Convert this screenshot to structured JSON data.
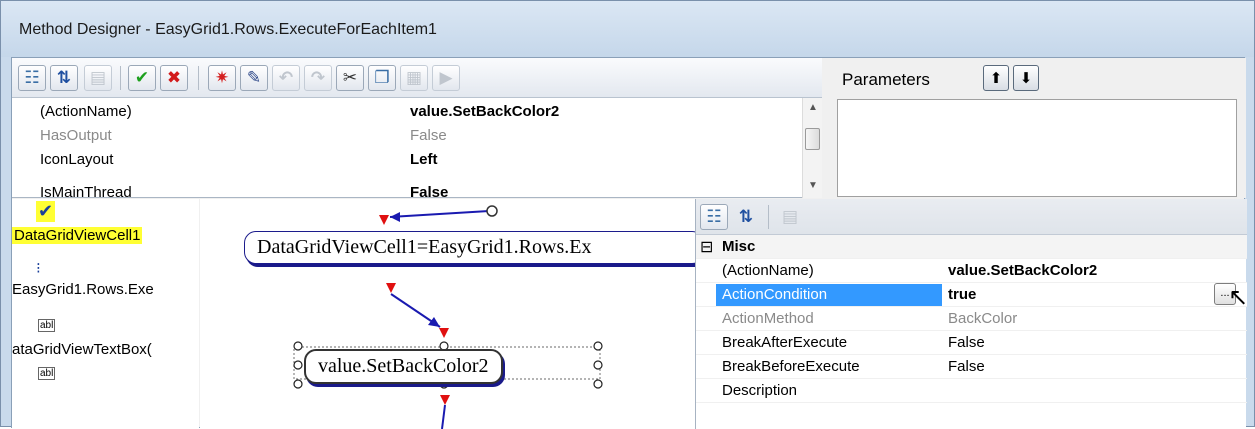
{
  "window": {
    "title": "Method Designer - EasyGrid1.Rows.ExecuteForEachItem1"
  },
  "toolbar": {
    "buttons": [
      {
        "name": "categorized-view-button",
        "glyph": "☷"
      },
      {
        "name": "alphabetical-sort-button",
        "glyph": "⇅"
      },
      {
        "name": "property-pages-button",
        "glyph": "▤"
      },
      {
        "name": "ok-button",
        "glyph": "✔"
      },
      {
        "name": "cancel-button",
        "glyph": "✖"
      },
      {
        "name": "debug-button",
        "glyph": "✷"
      },
      {
        "name": "magic-wand-button",
        "glyph": "✎"
      },
      {
        "name": "undo-button",
        "glyph": "↶"
      },
      {
        "name": "redo-button",
        "glyph": "↷"
      },
      {
        "name": "cut-button",
        "glyph": "✂"
      },
      {
        "name": "copy-button",
        "glyph": "❐"
      },
      {
        "name": "paste-button",
        "glyph": "▦"
      },
      {
        "name": "run-button",
        "glyph": "▶"
      }
    ]
  },
  "top_properties": [
    {
      "name": "(ActionName)",
      "value": "value.SetBackColor2",
      "name_style": "normal",
      "value_style": "bold"
    },
    {
      "name": "HasOutput",
      "value": "False",
      "name_style": "gray",
      "value_style": "gray"
    },
    {
      "name": "IconLayout",
      "value": "Left",
      "name_style": "normal",
      "value_style": "bold"
    },
    {
      "name": "IsMainThread",
      "value": "False",
      "name_style": "normal",
      "value_style": "bold"
    }
  ],
  "parameters": {
    "label": "Parameters",
    "move_up_glyph": "⬆",
    "move_down_glyph": "⬇"
  },
  "left_tree": {
    "items": [
      {
        "label": "DataGridViewCell1",
        "highlight": true,
        "icon": "✔"
      },
      {
        "label": "EasyGrid1.Rows.Exe",
        "highlight": false,
        "icon": "⁝"
      },
      {
        "label": "ataGridViewTextBox(",
        "highlight": false,
        "icon": "abl"
      },
      {
        "label": "",
        "highlight": false,
        "icon": "abl"
      }
    ]
  },
  "canvas": {
    "node1": "DataGridViewCell1=EasyGrid1.Rows.Ex",
    "node2": "value.SetBackColor2"
  },
  "right_grid": {
    "category": "Misc",
    "collapse_glyph": "⊟",
    "rows": [
      {
        "name": "(ActionName)",
        "value": "value.SetBackColor2",
        "name_style": "normal",
        "value_style": "bold"
      },
      {
        "name": "ActionCondition",
        "value": "true",
        "name_style": "selected",
        "value_style": "bold"
      },
      {
        "name": "ActionMethod",
        "value": "BackColor",
        "name_style": "gray",
        "value_style": "gray"
      },
      {
        "name": "BreakAfterExecute",
        "value": "False",
        "name_style": "normal",
        "value_style": "normal"
      },
      {
        "name": "BreakBeforeExecute",
        "value": "False",
        "name_style": "normal",
        "value_style": "normal"
      },
      {
        "name": "Description",
        "value": "",
        "name_style": "normal",
        "value_style": "normal"
      }
    ],
    "ellipsis_label": "..."
  }
}
